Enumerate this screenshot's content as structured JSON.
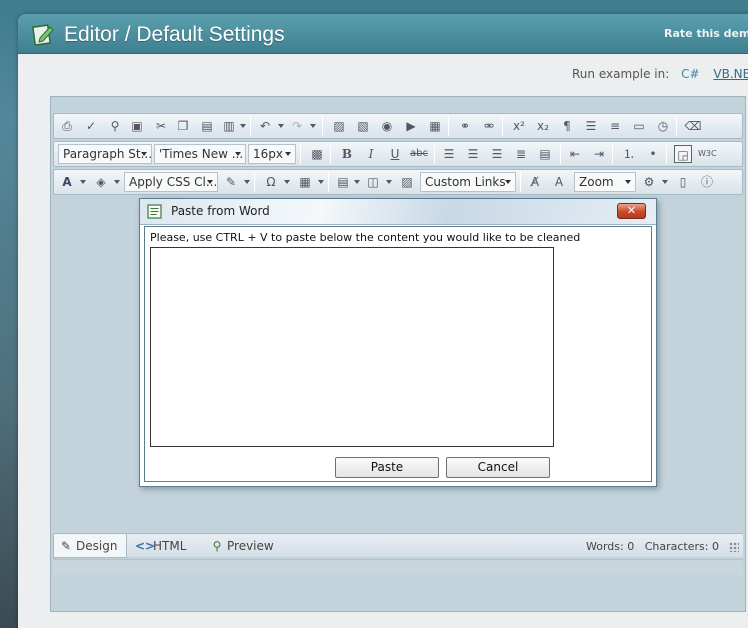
{
  "header": {
    "title": "Editor / Default Settings",
    "rate_label": "Rate this demo:"
  },
  "run_example": {
    "label": "Run example in:",
    "languages": [
      "C#",
      "VB.NET"
    ]
  },
  "toolbar": {
    "paragraph_style": "Paragraph St...",
    "font_name": "'Times New ...",
    "font_size": "16px",
    "css_class": "Apply CSS Cl...",
    "custom_links": "Custom Links",
    "zoom": "Zoom"
  },
  "dialog": {
    "title": "Paste from Word",
    "close_glyph": "✕",
    "instruction": "Please, use CTRL + V to paste below the content you would like to be cleaned",
    "paste_label": "Paste",
    "cancel_label": "Cancel"
  },
  "modes": {
    "design": "Design",
    "html": "HTML",
    "preview": "Preview"
  },
  "counts": {
    "words_label": "Words:",
    "words": "0",
    "chars_label": "Characters:",
    "chars": "0"
  },
  "colors": {
    "header": "#4a8c9b",
    "dialog_close": "#c9492b",
    "editor_bg": "#c3d3dc"
  },
  "icons": [
    "pencil-icon",
    "html-tag-icon",
    "magnifier-icon",
    "paste-word-icon",
    "edit-document-icon"
  ]
}
